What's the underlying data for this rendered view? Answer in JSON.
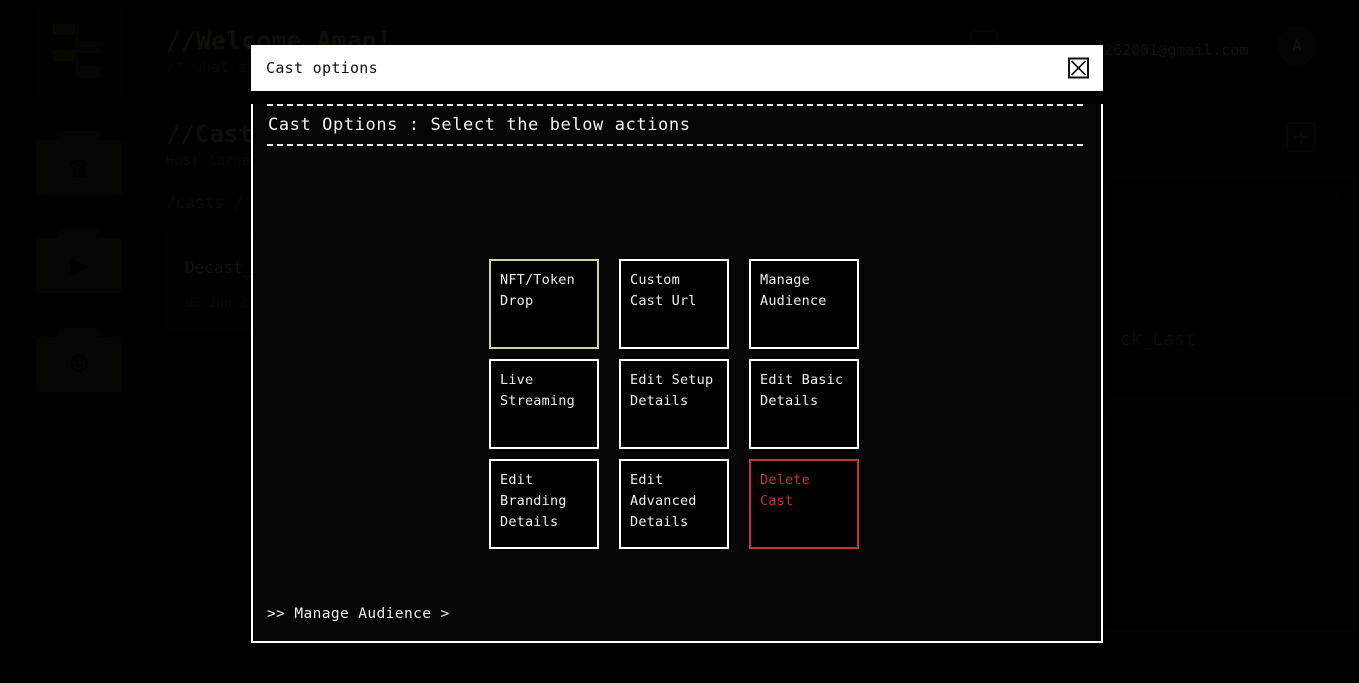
{
  "background": {
    "sidebar": {
      "logo_name": "decast-logo",
      "items": [
        {
          "name": "sidebar-item-calls",
          "icon": "phone-ring-icon",
          "glyph": "☎"
        },
        {
          "name": "sidebar-item-casts",
          "icon": "play-broadcast-icon",
          "glyph": "▶"
        },
        {
          "name": "sidebar-item-profile",
          "icon": "smiley-face-icon",
          "glyph": "☺"
        }
      ]
    },
    "header": {
      "welcome": "//Welcome Aman!",
      "subtitle": "/* what e",
      "email": "262001@gmail.com",
      "avatar_initial": "A",
      "bell_icon": "notification-bell-icon"
    },
    "page": {
      "title": "//Casts",
      "subtitle": "Host large",
      "breadcrumb": "/casts  /",
      "add_button_icon": "plus-icon"
    },
    "cards": {
      "left": {
        "title": "Decast_",
        "date": "02 Jun 2"
      },
      "right_label": "ck_Cast"
    }
  },
  "modal": {
    "title": "Cast options",
    "close_icon": "close-x-icon",
    "heading": "Cast Options : Select the below actions",
    "footer_link": ">> Manage Audience >",
    "colors": {
      "accent_border": "#ccd88c",
      "danger": "#c0392b",
      "text": "#f0f0f0",
      "titlebar_bg": "#ffffff"
    },
    "options": [
      {
        "label": "NFT/Token\nDrop",
        "name": "option-nft-token-drop",
        "style": "accent"
      },
      {
        "label": "Custom\nCast Url",
        "name": "option-custom-cast-url",
        "style": "normal"
      },
      {
        "label": "Manage\nAudience",
        "name": "option-manage-audience",
        "style": "normal"
      },
      {
        "label": "Live\nStreaming",
        "name": "option-live-streaming",
        "style": "normal"
      },
      {
        "label": "Edit Setup\nDetails",
        "name": "option-edit-setup-details",
        "style": "normal"
      },
      {
        "label": "Edit Basic\nDetails",
        "name": "option-edit-basic-details",
        "style": "normal"
      },
      {
        "label": "Edit\nBranding\nDetails",
        "name": "option-edit-branding-details",
        "style": "normal"
      },
      {
        "label": "Edit\nAdvanced\nDetails",
        "name": "option-edit-advanced-details",
        "style": "normal"
      },
      {
        "label": "Delete\nCast",
        "name": "option-delete-cast",
        "style": "danger"
      }
    ]
  }
}
